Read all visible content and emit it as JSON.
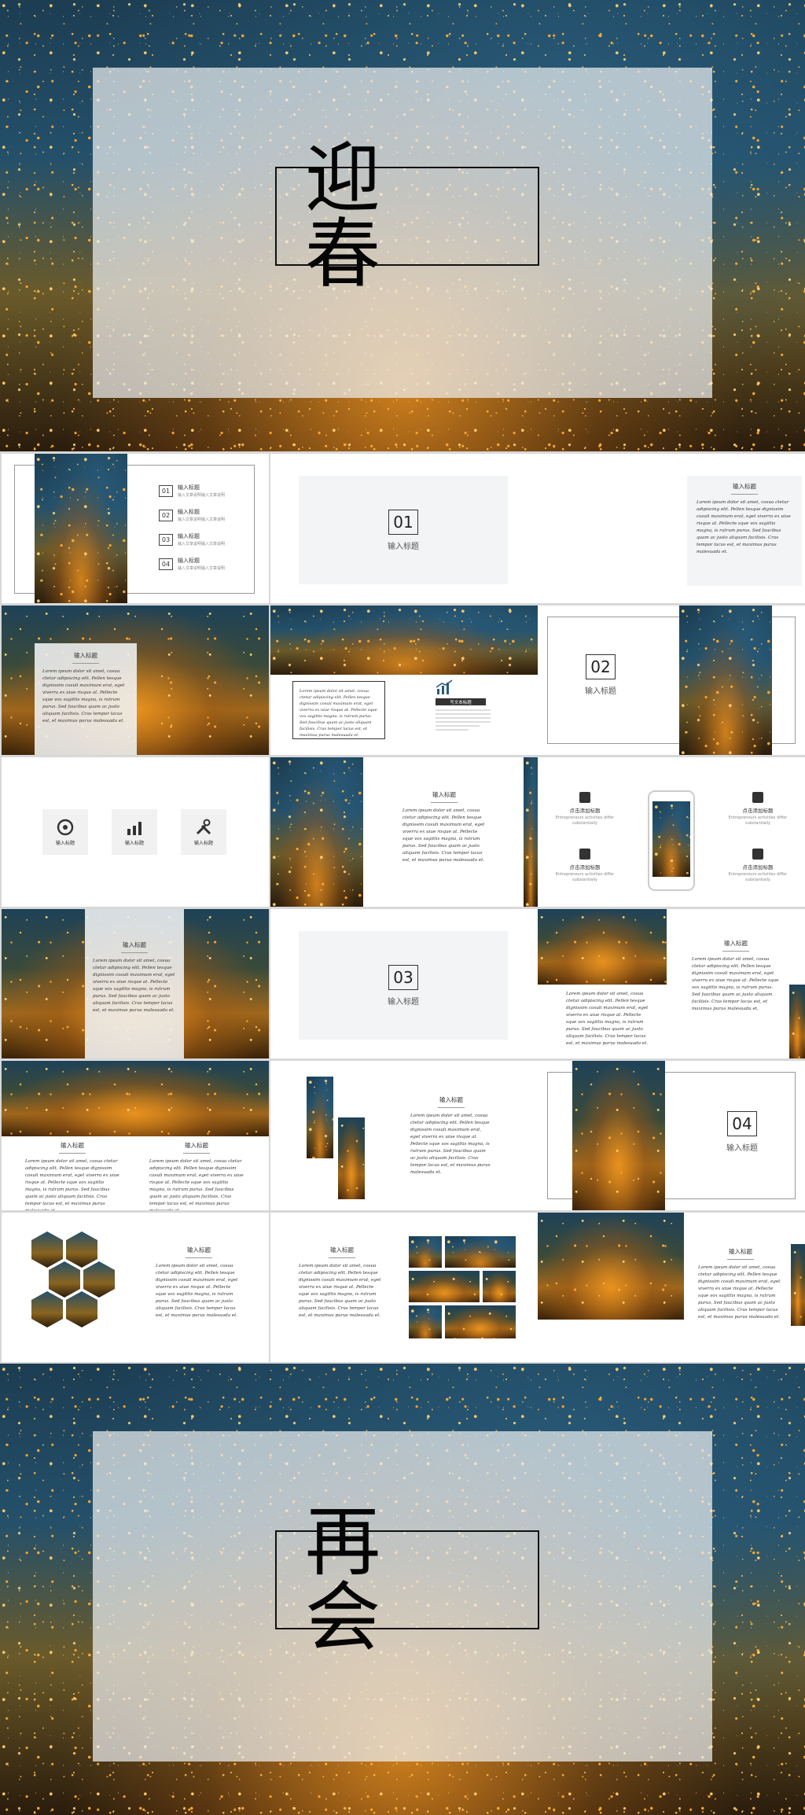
{
  "cover": {
    "title": "迎 春"
  },
  "ending": {
    "title": "再 会"
  },
  "lorem": "Lorem ipsum dolor sit amet, cosua ctetur adipiscing elit. Pellen tesque dignissim cosuli maximum erat, eget viverra ex uiue risque at. Pellecte sque vox sagittis magna, is rutrum purus. Sed faucibus quam ac justo aliquam facilisis. Cras tempor lacus est, et maximus purus malesuada et.",
  "heading": "输入标题",
  "toc": [
    {
      "num": "01",
      "title": "输入标题",
      "desc": "输入文章说明输入文章说明"
    },
    {
      "num": "02",
      "title": "输入标题",
      "desc": "输入文章说明输入文章说明"
    },
    {
      "num": "03",
      "title": "输入标题",
      "desc": "输入文章说明输入文章说明"
    },
    {
      "num": "04",
      "title": "输入标题",
      "desc": "输入文章说明输入文章说明"
    }
  ],
  "sections": [
    {
      "num": "01",
      "label": "输入标题"
    },
    {
      "num": "02",
      "label": "输入标题"
    },
    {
      "num": "03",
      "label": "输入标题"
    },
    {
      "num": "04",
      "label": "输入标题"
    }
  ],
  "chart_slide": {
    "tag": "写文本标题"
  },
  "icon_tiles": [
    "输入标题",
    "输入标题",
    "输入标题"
  ],
  "phone_features": [
    {
      "title": "点击添加标题",
      "desc": "Entrepreneurs activities differ substantially"
    },
    {
      "title": "点击添加标题",
      "desc": "Entrepreneurs activities differ substantially"
    },
    {
      "title": "点击添加标题",
      "desc": "Entrepreneurs activities differ substantially"
    },
    {
      "title": "点击添加标题",
      "desc": "Entrepreneurs activities differ substantially"
    }
  ]
}
